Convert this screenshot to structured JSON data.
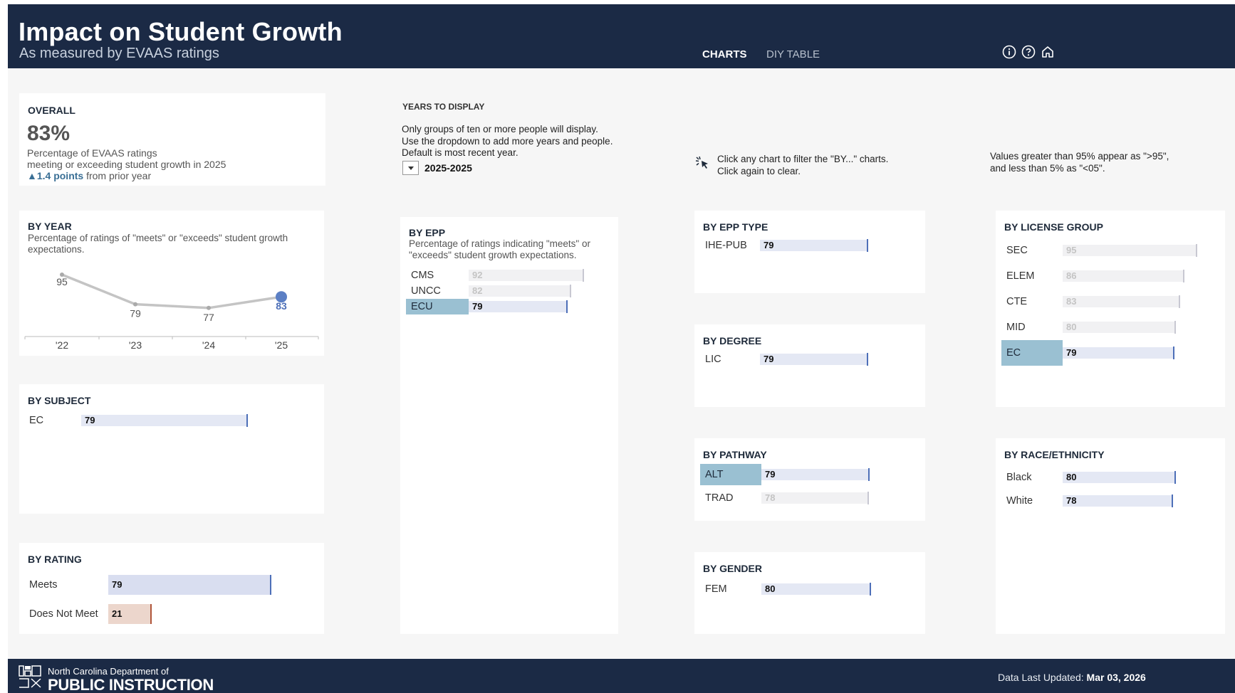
{
  "header": {
    "title": "Impact on Student Growth",
    "subtitle": "As measured by EVAAS ratings",
    "tabs": [
      "CHARTS",
      "DIY TABLE"
    ],
    "icons": [
      "info-icon",
      "help-icon",
      "home-icon"
    ]
  },
  "overall": {
    "title": "OVERALL",
    "value": "83%",
    "desc_line1": "Percentage of EVAAS ratings",
    "desc_line2": "meeting or exceeding student growth in 2025",
    "delta": "▲1.4 points",
    "delta_suffix": " from prior year"
  },
  "years": {
    "label": "YEARS TO DISPLAY",
    "note1": "Only groups of ten or more people will display.",
    "note2": "Use the dropdown to add more years and people.",
    "note3": "Default is most recent year.",
    "selected": "2025-2025"
  },
  "hint": {
    "line1": "Click any chart to filter the \"BY...\" charts.",
    "line2": "Click again to clear."
  },
  "values_note": {
    "line1": "Values greater than 95% appear as \">95\",",
    "line2": "and less than 5% as \"<05\"."
  },
  "by_year": {
    "title": "BY YEAR",
    "desc": "Percentage of ratings of \"meets\" or \"exceeds\" student growth expectations.",
    "chart_data": {
      "type": "line",
      "x": [
        "'22",
        "'23",
        "'24",
        "'25"
      ],
      "values": [
        95,
        79,
        77,
        83
      ],
      "value_labels": [
        "95",
        "79",
        "77",
        "83"
      ]
    }
  },
  "by_epp": {
    "title": "BY EPP",
    "desc": "Percentage of ratings indicating \"meets\" or \"exceeds\" student growth expectations.",
    "rows": [
      {
        "label": "CMS",
        "value": 92,
        "text": "92",
        "faded": true,
        "sel": false
      },
      {
        "label": "UNCC",
        "value": 82,
        "text": "82",
        "faded": true,
        "sel": false
      },
      {
        "label": "ECU",
        "value": 79,
        "text": "79",
        "faded": false,
        "sel": true
      }
    ]
  },
  "by_subject": {
    "title": "BY SUBJECT",
    "rows": [
      {
        "label": "EC",
        "value": 79,
        "text": "79",
        "faded": false,
        "sel": false
      }
    ]
  },
  "by_rating": {
    "title": "BY RATING",
    "rows": [
      {
        "label": "Meets",
        "value": 79,
        "text": "79",
        "color": "#d9def0",
        "mark": "#4d6fb8"
      },
      {
        "label": "Does Not Meet",
        "value": 21,
        "text": "21",
        "color": "#ecd6cc",
        "mark": "#b0553a"
      }
    ]
  },
  "by_epp_type": {
    "title": "BY EPP TYPE",
    "rows": [
      {
        "label": "IHE-PUB",
        "value": 79,
        "text": "79",
        "faded": false,
        "sel": false
      }
    ]
  },
  "by_degree": {
    "title": "BY DEGREE",
    "rows": [
      {
        "label": "LIC",
        "value": 79,
        "text": "79",
        "faded": false,
        "sel": false
      }
    ]
  },
  "by_pathway": {
    "title": "BY PATHWAY",
    "rows": [
      {
        "label": "ALT",
        "value": 79,
        "text": "79",
        "faded": false,
        "sel": true
      },
      {
        "label": "TRAD",
        "value": 78,
        "text": "78",
        "faded": true,
        "sel": false
      }
    ]
  },
  "by_gender": {
    "title": "BY GENDER",
    "rows": [
      {
        "label": "FEM",
        "value": 80,
        "text": "80",
        "faded": false,
        "sel": false
      }
    ]
  },
  "by_license": {
    "title": "BY LICENSE GROUP",
    "rows": [
      {
        "label": "SEC",
        "value": 95,
        "text": "95",
        "faded": true,
        "sel": false
      },
      {
        "label": "ELEM",
        "value": 86,
        "text": "86",
        "faded": true,
        "sel": false
      },
      {
        "label": "CTE",
        "value": 83,
        "text": "83",
        "faded": true,
        "sel": false
      },
      {
        "label": "MID",
        "value": 80,
        "text": "80",
        "faded": true,
        "sel": false
      },
      {
        "label": "EC",
        "value": 79,
        "text": "79",
        "faded": false,
        "sel": true
      }
    ]
  },
  "by_race": {
    "title": "BY RACE/ETHNICITY",
    "rows": [
      {
        "label": "Black",
        "value": 80,
        "text": "80",
        "faded": false,
        "sel": false
      },
      {
        "label": "White",
        "value": 78,
        "text": "78",
        "faded": false,
        "sel": false
      }
    ]
  },
  "footer": {
    "org_line1": "North Carolina Department of",
    "org_line2": "PUBLIC INSTRUCTION",
    "updated_label": "Data Last Updated: ",
    "updated_value": "Mar 03, 2026"
  },
  "colors": {
    "header_bg": "#1b2a45",
    "bar_track": "#e4e8f4",
    "bar_mark": "#4d6fb8",
    "selected": "#9ac0d2",
    "line": "#c4c4c4",
    "point_accent": "#5b7fc4"
  }
}
